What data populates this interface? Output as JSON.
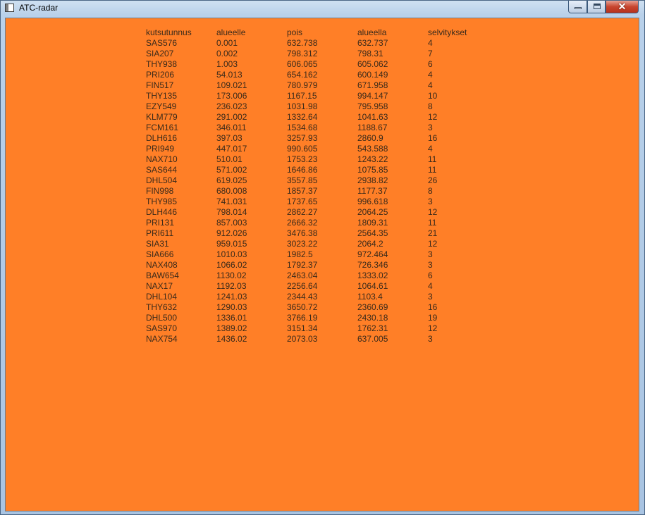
{
  "window": {
    "title": "ATC-radar",
    "app_icon": "window-app-icon",
    "controls": {
      "minimize_icon": "minimize-icon",
      "maximize_icon": "maximize-icon",
      "close_icon": "close-icon",
      "close_glyph": "✕"
    },
    "colors": {
      "client_background": "#ff7f27",
      "text": "#3a2a1a",
      "close_button": "#c7452f"
    }
  },
  "table": {
    "headers": [
      "kutsutunnus",
      "alueelle",
      "pois",
      "alueella",
      "selvitykset"
    ],
    "rows": [
      [
        "SAS576",
        "0.001",
        "632.738",
        "632.737",
        "4"
      ],
      [
        "SIA207",
        "0.002",
        "798.312",
        "798.31",
        "7"
      ],
      [
        "THY938",
        "1.003",
        "606.065",
        "605.062",
        "6"
      ],
      [
        "PRI206",
        "54.013",
        "654.162",
        "600.149",
        "4"
      ],
      [
        "FIN517",
        "109.021",
        "780.979",
        "671.958",
        "4"
      ],
      [
        "THY135",
        "173.006",
        "1167.15",
        "994.147",
        "10"
      ],
      [
        "EZY549",
        "236.023",
        "1031.98",
        "795.958",
        "8"
      ],
      [
        "KLM779",
        "291.002",
        "1332.64",
        "1041.63",
        "12"
      ],
      [
        "FCM161",
        "346.011",
        "1534.68",
        "1188.67",
        "3"
      ],
      [
        "DLH616",
        "397.03",
        "3257.93",
        "2860.9",
        "16"
      ],
      [
        "PRI949",
        "447.017",
        "990.605",
        "543.588",
        "4"
      ],
      [
        "NAX710",
        "510.01",
        "1753.23",
        "1243.22",
        "11"
      ],
      [
        "SAS644",
        "571.002",
        "1646.86",
        "1075.85",
        "11"
      ],
      [
        "DHL504",
        "619.025",
        "3557.85",
        "2938.82",
        "26"
      ],
      [
        "FIN998",
        "680.008",
        "1857.37",
        "1177.37",
        "8"
      ],
      [
        "THY985",
        "741.031",
        "1737.65",
        "996.618",
        "3"
      ],
      [
        "DLH446",
        "798.014",
        "2862.27",
        "2064.25",
        "12"
      ],
      [
        "PRI131",
        "857.003",
        "2666.32",
        "1809.31",
        "11"
      ],
      [
        "PRI611",
        "912.026",
        "3476.38",
        "2564.35",
        "21"
      ],
      [
        "SIA31",
        "959.015",
        "3023.22",
        "2064.2",
        "12"
      ],
      [
        "SIA666",
        "1010.03",
        "1982.5",
        "972.464",
        "3"
      ],
      [
        "NAX408",
        "1066.02",
        "1792.37",
        "726.346",
        "3"
      ],
      [
        "BAW654",
        "1130.02",
        "2463.04",
        "1333.02",
        "6"
      ],
      [
        "NAX17",
        "1192.03",
        "2256.64",
        "1064.61",
        "4"
      ],
      [
        "DHL104",
        "1241.03",
        "2344.43",
        "1103.4",
        "3"
      ],
      [
        "THY632",
        "1290.03",
        "3650.72",
        "2360.69",
        "16"
      ],
      [
        "DHL500",
        "1336.01",
        "3766.19",
        "2430.18",
        "19"
      ],
      [
        "SAS970",
        "1389.02",
        "3151.34",
        "1762.31",
        "12"
      ],
      [
        "NAX754",
        "1436.02",
        "2073.03",
        "637.005",
        "3"
      ]
    ]
  }
}
